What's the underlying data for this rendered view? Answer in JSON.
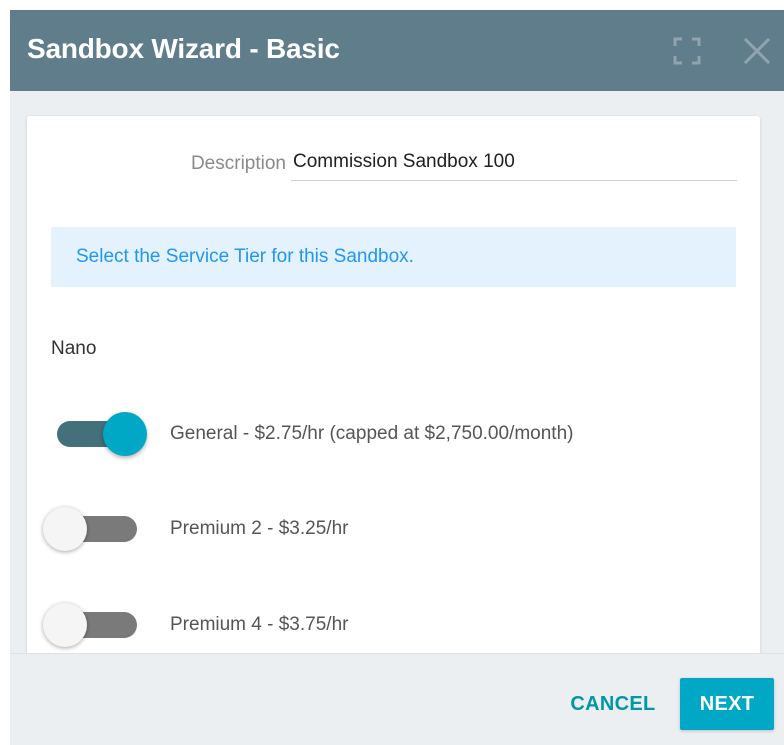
{
  "dialog": {
    "title": "Sandbox Wizard - Basic",
    "header_bg": "#607d8b",
    "icons": {
      "expand": "expand-icon",
      "close": "close-icon"
    }
  },
  "form": {
    "description_label": "Description",
    "description_value": "Commission Sandbox 100",
    "info_text": "Select the Service Tier for this Sandbox.",
    "group_label": "Nano",
    "options": [
      {
        "label": "General - $2.75/hr (capped at $2,750.00/month)",
        "selected": true
      },
      {
        "label": "Premium 2 - $3.25/hr",
        "selected": false
      },
      {
        "label": "Premium 4 - $3.75/hr",
        "selected": false
      }
    ]
  },
  "footer": {
    "cancel_label": "CANCEL",
    "next_label": "NEXT"
  },
  "colors": {
    "accent": "#00a8c6",
    "info_bg": "#e3f2fd",
    "info_text": "#2196f3"
  }
}
